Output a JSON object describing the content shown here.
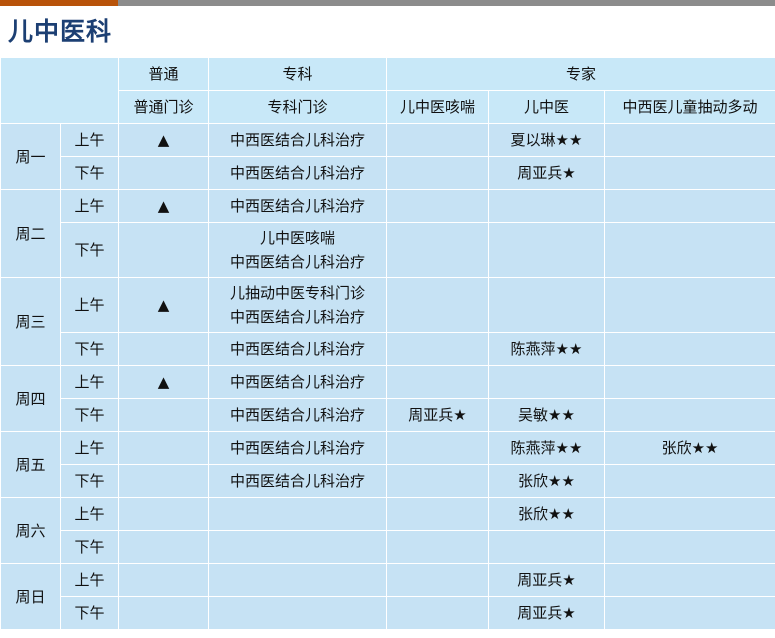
{
  "title": "儿中医科",
  "headers": {
    "normal": "普通",
    "specialty": "专科",
    "expert": "专家",
    "normal_clinic": "普通门诊",
    "specialty_clinic": "专科门诊",
    "cough": "儿中医咳喘",
    "tcm": "儿中医",
    "tic": "中西医儿童抽动多动"
  },
  "days": [
    {
      "name": "周一",
      "slots": [
        {
          "label": "上午",
          "normal": "▲",
          "specialty": [
            "中西医结合儿科治疗"
          ],
          "cough": "",
          "tcm": "夏以琳★★",
          "tic": ""
        },
        {
          "label": "下午",
          "normal": "",
          "specialty": [
            "中西医结合儿科治疗"
          ],
          "cough": "",
          "tcm": "周亚兵★",
          "tic": ""
        }
      ]
    },
    {
      "name": "周二",
      "slots": [
        {
          "label": "上午",
          "normal": "▲",
          "specialty": [
            "中西医结合儿科治疗"
          ],
          "cough": "",
          "tcm": "",
          "tic": ""
        },
        {
          "label": "下午",
          "normal": "",
          "specialty": [
            "儿中医咳喘",
            "中西医结合儿科治疗"
          ],
          "cough": "",
          "tcm": "",
          "tic": ""
        }
      ]
    },
    {
      "name": "周三",
      "slots": [
        {
          "label": "上午",
          "normal": "▲",
          "specialty": [
            "儿抽动中医专科门诊",
            "中西医结合儿科治疗"
          ],
          "cough": "",
          "tcm": "",
          "tic": ""
        },
        {
          "label": "下午",
          "normal": "",
          "specialty": [
            "中西医结合儿科治疗"
          ],
          "cough": "",
          "tcm": "陈燕萍★★",
          "tic": ""
        }
      ]
    },
    {
      "name": "周四",
      "slots": [
        {
          "label": "上午",
          "normal": "▲",
          "specialty": [
            "中西医结合儿科治疗"
          ],
          "cough": "",
          "tcm": "",
          "tic": ""
        },
        {
          "label": "下午",
          "normal": "",
          "specialty": [
            "中西医结合儿科治疗"
          ],
          "cough": "周亚兵★",
          "tcm": "吴敏★★",
          "tic": ""
        }
      ]
    },
    {
      "name": "周五",
      "slots": [
        {
          "label": "上午",
          "normal": "",
          "specialty": [
            "中西医结合儿科治疗"
          ],
          "cough": "",
          "tcm": "陈燕萍★★",
          "tic": "张欣★★"
        },
        {
          "label": "下午",
          "normal": "",
          "specialty": [
            "中西医结合儿科治疗"
          ],
          "cough": "",
          "tcm": "张欣★★",
          "tic": ""
        }
      ]
    },
    {
      "name": "周六",
      "slots": [
        {
          "label": "上午",
          "normal": "",
          "specialty": [],
          "cough": "",
          "tcm": "张欣★★",
          "tic": ""
        },
        {
          "label": "下午",
          "normal": "",
          "specialty": [],
          "cough": "",
          "tcm": "",
          "tic": ""
        }
      ]
    },
    {
      "name": "周日",
      "slots": [
        {
          "label": "上午",
          "normal": "",
          "specialty": [],
          "cough": "",
          "tcm": "周亚兵★",
          "tic": ""
        },
        {
          "label": "下午",
          "normal": "",
          "specialty": [],
          "cough": "",
          "tcm": "周亚兵★",
          "tic": ""
        }
      ]
    }
  ]
}
